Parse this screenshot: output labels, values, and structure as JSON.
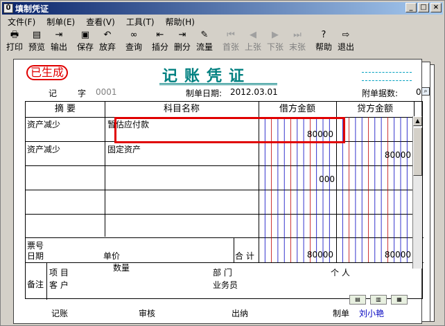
{
  "window": {
    "title": "填制凭证"
  },
  "menu": [
    "文件(F)",
    "制单(E)",
    "查看(V)",
    "工具(T)",
    "帮助(H)"
  ],
  "toolbar": [
    {
      "label": "打印",
      "icon": "printer-icon",
      "glyph": "🖶",
      "enabled": true
    },
    {
      "label": "预览",
      "icon": "preview-icon",
      "glyph": "▤",
      "enabled": true
    },
    {
      "label": "输出",
      "icon": "export-icon",
      "glyph": "⇥",
      "enabled": true
    },
    {
      "label": "保存",
      "icon": "save-icon",
      "glyph": "▣",
      "enabled": true
    },
    {
      "label": "放弃",
      "icon": "undo-icon",
      "glyph": "↶",
      "enabled": true
    },
    {
      "label": "查询",
      "icon": "binoculars-icon",
      "glyph": "∞",
      "enabled": true
    },
    {
      "label": "插分",
      "icon": "insert-row-icon",
      "glyph": "⇤",
      "enabled": true
    },
    {
      "label": "删分",
      "icon": "delete-row-icon",
      "glyph": "⇥",
      "enabled": true
    },
    {
      "label": "流量",
      "icon": "flow-icon",
      "glyph": "✎",
      "enabled": true
    },
    {
      "label": "首张",
      "icon": "first-icon",
      "glyph": "⏮",
      "enabled": false
    },
    {
      "label": "上张",
      "icon": "prev-icon",
      "glyph": "◀",
      "enabled": false
    },
    {
      "label": "下张",
      "icon": "next-icon",
      "glyph": "▶",
      "enabled": false
    },
    {
      "label": "末张",
      "icon": "last-icon",
      "glyph": "⏭",
      "enabled": false
    },
    {
      "label": "帮助",
      "icon": "help-icon",
      "glyph": "?",
      "enabled": true
    },
    {
      "label": "退出",
      "icon": "exit-icon",
      "glyph": "⇨",
      "enabled": true
    }
  ],
  "voucher": {
    "stamp": "已生成",
    "title": "记账凭证",
    "type_label": "记",
    "zi_label": "字",
    "number": "0001",
    "date_label": "制单日期:",
    "date": "2012.03.01",
    "attach_label": "附单据数:",
    "attach_count": "0",
    "headers": {
      "summary": "摘 要",
      "account": "科目名称",
      "debit": "借方金额",
      "credit": "贷方金额"
    },
    "rows": [
      {
        "summary": "资产减少",
        "account": "暂估应付款",
        "debit": "80000",
        "credit": ""
      },
      {
        "summary": "资产减少",
        "account": "固定资产",
        "debit": "",
        "credit": "80000"
      },
      {
        "summary": "",
        "account": "",
        "debit": "000",
        "credit": ""
      },
      {
        "summary": "",
        "account": "",
        "debit": "",
        "credit": ""
      },
      {
        "summary": "",
        "account": "",
        "debit": "",
        "credit": ""
      }
    ],
    "bottom": {
      "ticket_label": "票号",
      "date_label": "日期",
      "unit_price_label": "单价",
      "quantity_label": "数量",
      "total_label": "合 计",
      "total_debit": "80000",
      "total_credit": "80000"
    },
    "remarks": {
      "label": "备注",
      "project_label": "项 目",
      "dept_label": "部 门",
      "person_label": "个 人",
      "customer_label": "客 户",
      "salesman_label": "业务员"
    },
    "signatures": {
      "bookkeeper_label": "记账",
      "reviewer_label": "审核",
      "cashier_label": "出纳",
      "maker_label": "制单",
      "maker_name": "刘小艳"
    }
  },
  "colors": {
    "accent": "#008080",
    "stamp": "#e00000",
    "highlight": "#e00000"
  }
}
